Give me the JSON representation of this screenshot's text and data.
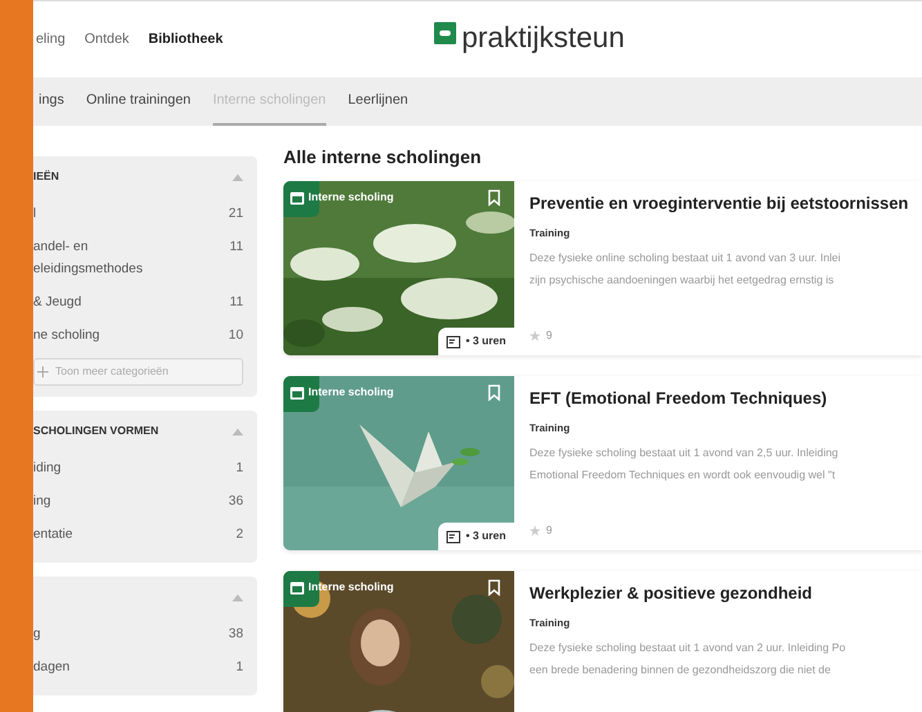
{
  "nav": [
    {
      "label": "eling",
      "selected": false
    },
    {
      "label": "Ontdek",
      "selected": false
    },
    {
      "label": "Bibliotheek",
      "selected": true
    }
  ],
  "logo": {
    "text": "praktijksteun"
  },
  "tabs": [
    {
      "label": "ings",
      "selected": false
    },
    {
      "label": "Online trainingen",
      "selected": false
    },
    {
      "label": "Interne scholingen",
      "selected": true
    },
    {
      "label": "Leerlijnen",
      "selected": false
    }
  ],
  "filters": [
    {
      "title": "IEËN",
      "expanded": true,
      "items": [
        {
          "label": "l",
          "count": "21"
        },
        {
          "label": "andel- en\neleidingsmethodes",
          "count": "11"
        },
        {
          "label": "& Jeugd",
          "count": "11"
        },
        {
          "label": "ne scholing",
          "count": "10"
        }
      ],
      "more": "Toon meer categorieën"
    },
    {
      "title": "SCHOLINGEN VORMEN",
      "expanded": true,
      "items": [
        {
          "label": "iding",
          "count": "1"
        },
        {
          "label": "ing",
          "count": "36"
        },
        {
          "label": "entatie",
          "count": "2"
        }
      ]
    },
    {
      "expanded": true,
      "items": [
        {
          "label": "g",
          "count": "38"
        },
        {
          "label": "dagen",
          "count": "1"
        }
      ]
    }
  ],
  "heading": "Alle interne scholingen",
  "courses": [
    {
      "badge": "Interne scholing",
      "kind": "picture",
      "duration": "• 3 uren",
      "title": "Preventie en vroeginterventie bij eetstoornissen",
      "type": "Training",
      "description": [
        "Deze fysieke online scholing bestaat uit 1 avond van 3 uur. Inlei",
        "zijn psychische aandoeningen waarbij het eetgedrag ernstig is"
      ],
      "rating": "9"
    },
    {
      "badge": "Interne scholing",
      "kind": "picture",
      "duration": "• 3 uren",
      "title": "EFT (Emotional Freedom Techniques)",
      "type": "Training",
      "description": [
        "Deze fysieke scholing bestaat uit 1 avond van 2,5 uur. Inleiding",
        "Emotional Freedom Techniques en wordt ook eenvoudig wel \"t"
      ],
      "rating": "9"
    },
    {
      "badge": "Interne scholing",
      "kind": "picture",
      "title": "Werkplezier & positieve gezondheid",
      "type": "Training",
      "description": [
        "Deze fysieke scholing bestaat uit 1 avond van 2 uur. Inleiding Po",
        "een brede benadering binnen de gezondheidszorg die niet de"
      ]
    }
  ]
}
